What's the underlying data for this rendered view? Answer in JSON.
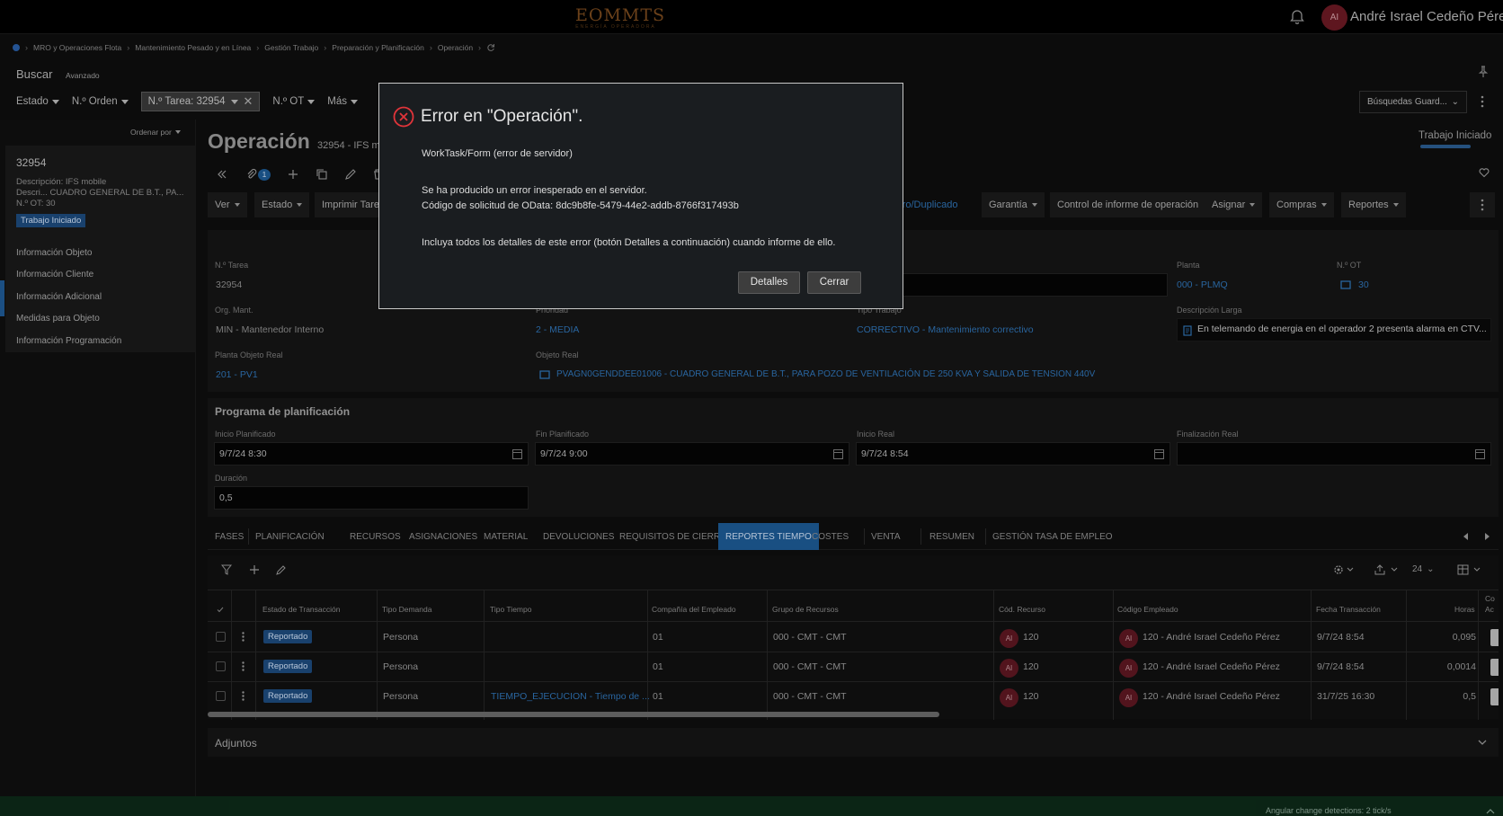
{
  "header": {
    "logo_text": "EOMMTS",
    "logo_subtext": "ENERGÍA OPERADORA",
    "user_initials": "AI",
    "user_name": "André Israel Cedeño Pérez"
  },
  "breadcrumb": [
    "MRO y Operaciones Flota",
    "Mantenimiento Pesado y en Línea",
    "Gestión Trabajo",
    "Preparación y Planificación",
    "Operación"
  ],
  "search": {
    "title": "Buscar",
    "advanced": "Avanzado",
    "filters": [
      "Estado",
      "N.º Orden"
    ],
    "active_chip": "N.º Tarea: 32954",
    "filters_after": [
      "N.º OT",
      "Más"
    ],
    "saved_searches": "Búsquedas Guard..."
  },
  "sidebar": {
    "sort_label": "Ordenar por",
    "record": {
      "id": "32954",
      "desc_line1": "Descripción:  IFS mobile",
      "desc_line2": "Descri...   CUADRO GENERAL DE B.T., PA...",
      "ot_line": "N.º OT:  30",
      "status": "Trabajo Iniciado"
    },
    "links": [
      "Información Objeto",
      "Información Cliente",
      "Información Adicional",
      "Medidas para Objeto",
      "Información Programación"
    ]
  },
  "page": {
    "title": "Operación",
    "subtitle": "32954 - IFS m",
    "state": "Trabajo Iniciado",
    "attach_count": "1"
  },
  "actions": {
    "left": [
      "Ver",
      "Estado",
      "Imprimir Tare"
    ],
    "registro": "estro/Duplicado",
    "right": [
      "Garantía",
      "Control de informe de operación",
      "Asignar",
      "Compras",
      "Reportes"
    ]
  },
  "details": {
    "task_no_label": "N.º Tarea",
    "task_no": "32954",
    "org_label": "Org. Mant.",
    "org": "MIN - Mantenedor Interno",
    "priority_label": "Prioridad",
    "priority": "2 - MEDIA",
    "work_type_label": "Tipo Trabajo",
    "work_type": "CORRECTIVO - Mantenimiento correctivo",
    "plant_label": "Planta",
    "plant": "000 - PLMQ",
    "ot_label": "N.º OT",
    "ot": "30",
    "long_desc_label": "Descripción Larga",
    "long_desc": "En telemando de energia en el operador 2 presenta alarma en CTV...",
    "real_plant_label": "Planta Objeto Real",
    "real_plant": "201 - PV1",
    "real_object_label": "Objeto Real",
    "real_object": "PVAGN0GENDDEE01006 - CUADRO GENERAL DE B.T., PARA POZO DE VENTILACIÓN DE 250 KVA Y SALIDA DE TENSION 440V"
  },
  "planning": {
    "title": "Programa de planificación",
    "start_planned_label": "Inicio Planificado",
    "start_planned": "9/7/24 8:30",
    "end_planned_label": "Fin Planificado",
    "end_planned": "9/7/24 9:00",
    "start_real_label": "Inicio Real",
    "start_real": "9/7/24 8:54",
    "end_real_label": "Finalización Real",
    "end_real": "",
    "duration_label": "Duración",
    "duration": "0,5"
  },
  "tabs": [
    "FASES",
    "PLANIFICACIÓN",
    "RECURSOS",
    "ASIGNACIONES",
    "MATERIAL",
    "DEVOLUCIONES",
    "REQUISITOS DE CIERRE",
    "REPORTES TIEMPO",
    "COSTES",
    "VENTA",
    "RESUMEN",
    "GESTIÓN TASA DE EMPLEO"
  ],
  "table": {
    "page_size": "24",
    "headers": [
      "Estado de Transacción",
      "Tipo Demanda",
      "Tipo Tiempo",
      "Compañía del Empleado",
      "Grupo de Recursos",
      "Cód. Recurso",
      "Código Empleado",
      "Fecha Transacción",
      "Horas",
      "Co",
      "Ac"
    ],
    "rows": [
      {
        "status": "Reportado",
        "demand": "Persona",
        "time_type": "",
        "company": "01",
        "group": "000 - CMT - CMT",
        "resource": "120",
        "employee": "120 - André Israel Cedeño Pérez",
        "date": "9/7/24 8:54",
        "hours": "0,095"
      },
      {
        "status": "Reportado",
        "demand": "Persona",
        "time_type": "",
        "company": "01",
        "group": "000 - CMT - CMT",
        "resource": "120",
        "employee": "120 - André Israel Cedeño Pérez",
        "date": "9/7/24 8:54",
        "hours": "0,0014"
      },
      {
        "status": "Reportado",
        "demand": "Persona",
        "time_type": "TIEMPO_EJECUCION - Tiempo de ...",
        "company": "01",
        "group": "000 - CMT - CMT",
        "resource": "120",
        "employee": "120 - André Israel Cedeño Pérez",
        "date": "31/7/25 16:30",
        "hours": "0,5"
      }
    ],
    "avatar_initials": "AI"
  },
  "attachments": {
    "title": "Adjuntos"
  },
  "footer": {
    "text": "Angular change detections: 2 tick/s"
  },
  "dialog": {
    "title": "Error en \"Operación\".",
    "subtitle": "WorkTask/Form (error de servidor)",
    "message1": "Se ha producido un error inesperado en el servidor.",
    "message2": "Código de solicitud de OData: 8dc9b8fe-5479-44e2-addb-8766f317493b",
    "message3": "Incluya todos los detalles de este error (botón Detalles a continuación) cuando informe de ello.",
    "details_button": "Detalles",
    "close_button": "Cerrar"
  },
  "colors": {
    "accent": "#1d5a94",
    "link": "#2f73b5",
    "error": "#e0343a",
    "footer": "#0d2a18"
  }
}
